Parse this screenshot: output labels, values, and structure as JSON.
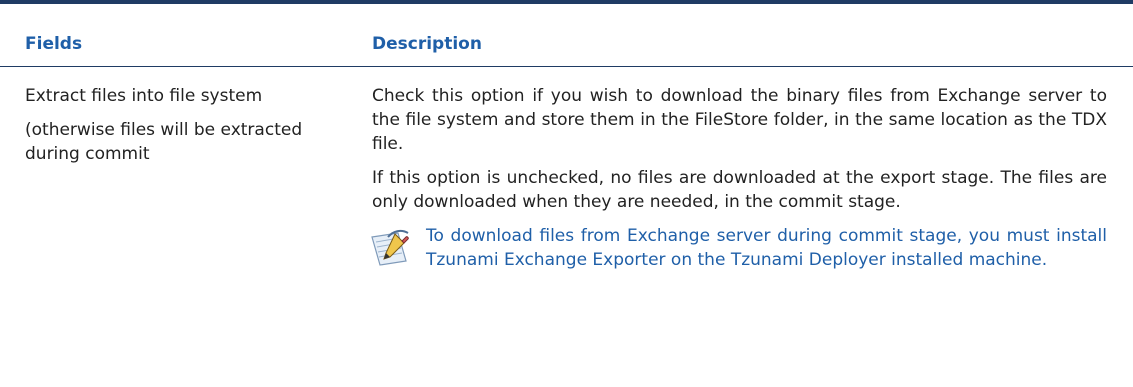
{
  "table": {
    "headers": {
      "fields": "Fields",
      "description": "Description"
    },
    "row": {
      "field_title": "Extract files into file system",
      "field_note": "(otherwise files will be extracted during commit",
      "description_paragraph_1": "Check this option if you wish to download the binary files from Exchange server to the file system and store them in the FileStore folder, in the same location as the TDX file.",
      "description_paragraph_2": "If this option is unchecked, no files are downloaded at the export stage. The files are only downloaded when they are needed, in the commit stage.",
      "note_icon_name": "note-pencil-icon",
      "note_text": "To download files from Exchange server during commit stage, you must install Tzunami Exchange Exporter on the Tzunami Deployer installed machine."
    }
  }
}
